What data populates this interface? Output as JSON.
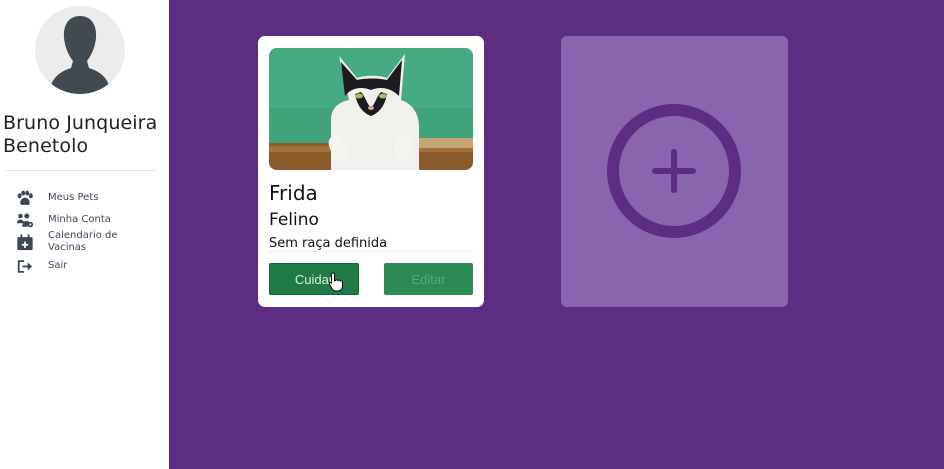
{
  "sidebar": {
    "user_name": "Bruno Junqueira Benetolo",
    "items": [
      {
        "label": "Meus Pets",
        "icon": "paw-icon"
      },
      {
        "label": "Minha Conta",
        "icon": "users-gear-icon"
      },
      {
        "label": "Calendario de Vacinas",
        "icon": "calendar-plus-icon"
      },
      {
        "label": "Sair",
        "icon": "logout-icon"
      }
    ]
  },
  "pets": [
    {
      "name": "Frida",
      "species": "Felino",
      "breed": "Sem raça definida",
      "care_label": "Cuidar",
      "edit_label": "Editar"
    }
  ],
  "add_card": {
    "icon": "plus-circle-icon"
  },
  "colors": {
    "background": "#5c2d82",
    "add_card": "#8a65ad",
    "button_green": "#1f7a45"
  }
}
